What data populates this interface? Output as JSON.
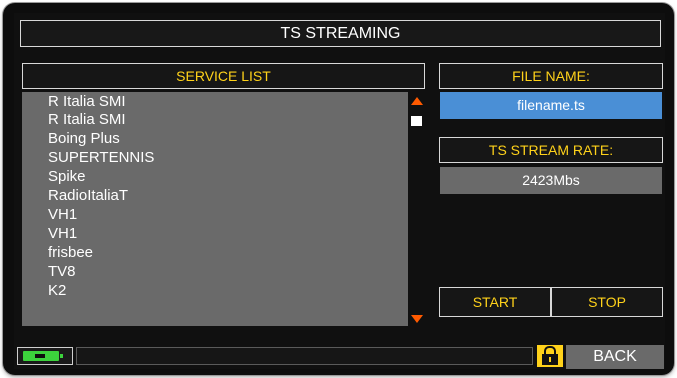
{
  "title": "TS STREAMING",
  "service_list": {
    "header": "SERVICE LIST",
    "items": [
      "R Italia SMI",
      "R Italia SMI",
      "Boing Plus",
      "SUPERTENNIS",
      "Spike",
      "RadioItaliaT",
      "VH1",
      "VH1",
      "frisbee",
      "TV8",
      "K2"
    ]
  },
  "file_name": {
    "header": "FILE NAME:",
    "value": "filename.ts"
  },
  "stream_rate": {
    "header": "TS STREAM RATE:",
    "value": "2423Mbs"
  },
  "buttons": {
    "start": "START",
    "stop": "STOP",
    "back": "BACK"
  },
  "colors": {
    "accent_text": "#ffd21a",
    "selected_field": "#4a8fd6",
    "field_gray": "#6a6a6a",
    "scroll_arrow": "#ff5a00",
    "battery": "#3cd23c"
  },
  "icons": {
    "battery": "battery-icon",
    "lock": "lock-icon",
    "scroll_up": "scroll-up-icon",
    "scroll_down": "scroll-down-icon"
  }
}
